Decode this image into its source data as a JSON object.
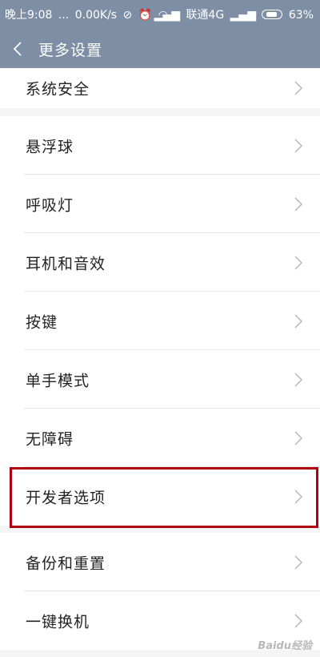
{
  "status_bar": {
    "time": "晚上9:08",
    "dots": "...",
    "speed": "0.00K/s",
    "carrier": "联通4G",
    "battery": "63%"
  },
  "header": {
    "title": "更多设置"
  },
  "groups": [
    {
      "items": [
        {
          "label": "系统安全"
        }
      ]
    },
    {
      "items": [
        {
          "label": "悬浮球"
        },
        {
          "label": "呼吸灯"
        },
        {
          "label": "耳机和音效"
        },
        {
          "label": "按键"
        },
        {
          "label": "单手模式"
        },
        {
          "label": "无障碍"
        },
        {
          "label": "开发者选项"
        }
      ]
    },
    {
      "items": [
        {
          "label": "备份和重置"
        },
        {
          "label": "一键换机"
        }
      ]
    }
  ],
  "watermark": "Baidu经验",
  "colors": {
    "header_bg": "#7e8ea5",
    "highlight_border": "#b00010"
  }
}
